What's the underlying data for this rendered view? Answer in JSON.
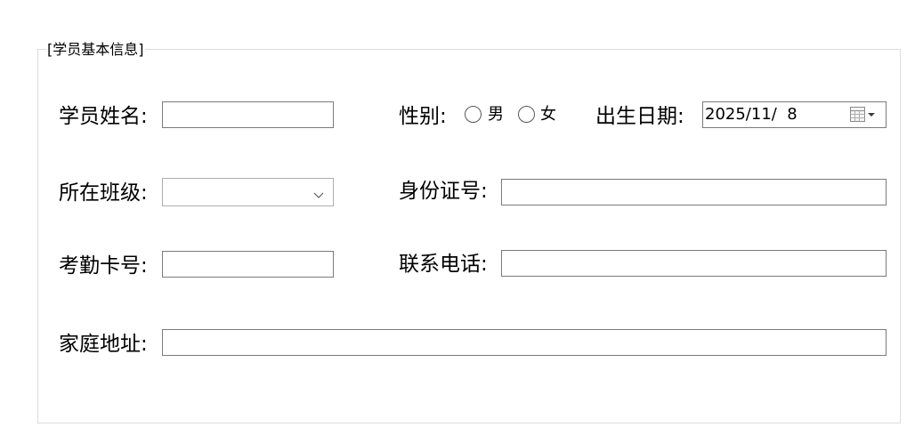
{
  "group": {
    "title": "[学员基本信息]"
  },
  "fields": {
    "name_label": "学员姓名:",
    "name_value": "",
    "gender_label": "性别:",
    "gender_options": [
      "男",
      "女"
    ],
    "birthdate_label": "出生日期:",
    "birthdate_value": "2025/11/  8",
    "class_label": "所在班级:",
    "class_selected": "",
    "id_label": "身份证号:",
    "id_value": "",
    "card_label": "考勤卡号:",
    "card_value": "",
    "phone_label": "联系电话:",
    "phone_value": "",
    "address_label": "家庭地址:",
    "address_value": ""
  },
  "icons": {
    "dropdown": "chevron-down-icon",
    "calendar": "calendar-icon"
  }
}
